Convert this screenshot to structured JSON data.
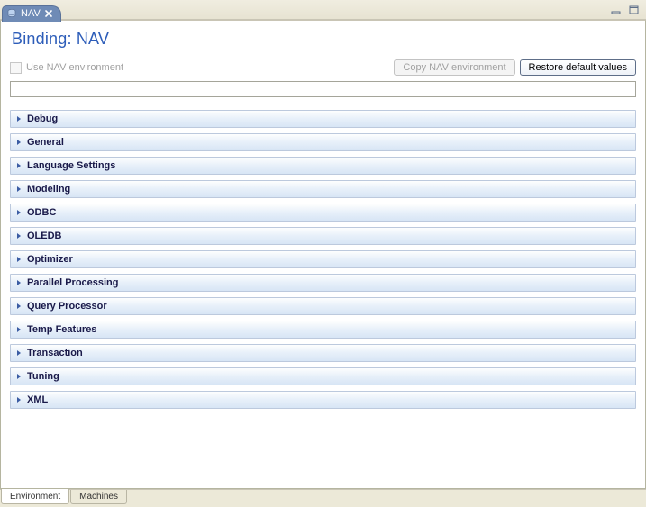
{
  "titlebar": {
    "tab_label": "NAV"
  },
  "heading": "Binding: NAV",
  "checkbox_label": "Use NAV environment",
  "buttons": {
    "copy": "Copy NAV environment",
    "restore": "Restore default values"
  },
  "sections": [
    {
      "label": "Debug"
    },
    {
      "label": "General"
    },
    {
      "label": "Language Settings"
    },
    {
      "label": "Modeling"
    },
    {
      "label": "ODBC"
    },
    {
      "label": "OLEDB"
    },
    {
      "label": "Optimizer"
    },
    {
      "label": "Parallel Processing"
    },
    {
      "label": "Query Processor"
    },
    {
      "label": "Temp Features"
    },
    {
      "label": "Transaction"
    },
    {
      "label": "Tuning"
    },
    {
      "label": "XML"
    }
  ],
  "bottom_tabs": {
    "environment": "Environment",
    "machines": "Machines"
  },
  "colors": {
    "heading": "#2d5db9",
    "section_gradient_top": "#fdfefe",
    "section_gradient_bottom": "#d7e5f5",
    "tab_bg": "#6f8bb6"
  }
}
